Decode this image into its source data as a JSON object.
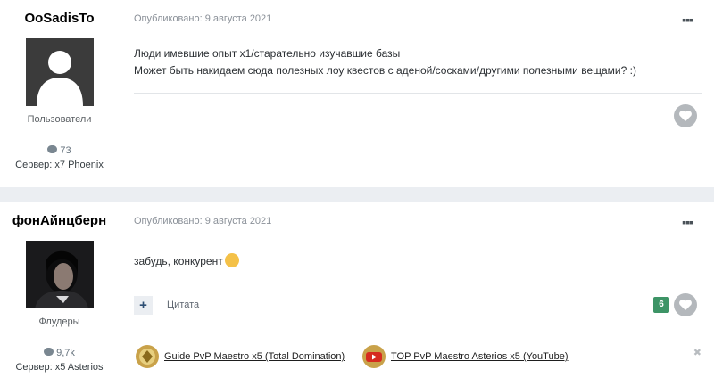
{
  "posts": [
    {
      "author": "OoSadisTo",
      "group": "Пользователи",
      "post_count": "73",
      "server": "Сервер: x7 Phoenix",
      "published": "Опубликовано: 9 августа 2021",
      "lines": [
        "Люди имевшие опыт х1/старательно изучавшие базы",
        "Может быть накидаем сюда полезных лоу квестов с аденой/сосками/другими полезными вещами? :)"
      ]
    },
    {
      "author": "фонАйнцберн",
      "group": "Флудеры",
      "post_count": "9,7k",
      "server": "Сервер: x5 Asterios",
      "published": "Опубликовано: 9 августа 2021",
      "text": "забудь, конкурент",
      "quote_label": "Цитата",
      "reaction_count": "6",
      "signature": [
        "Guide PvP Maestro x5 (Total Domination)",
        "TOP PvP Maestro Asterios x5 (YouTube)"
      ]
    }
  ],
  "icons": {
    "menu": "ellipsis-icon",
    "like": "heart-icon",
    "comments": "speech-bubble-icon",
    "quote": "plus-icon",
    "close": "close-icon"
  },
  "colors": {
    "reaction": "#3d9466",
    "like": "#b4b8bc",
    "quote_plus": "#2e4f74"
  }
}
